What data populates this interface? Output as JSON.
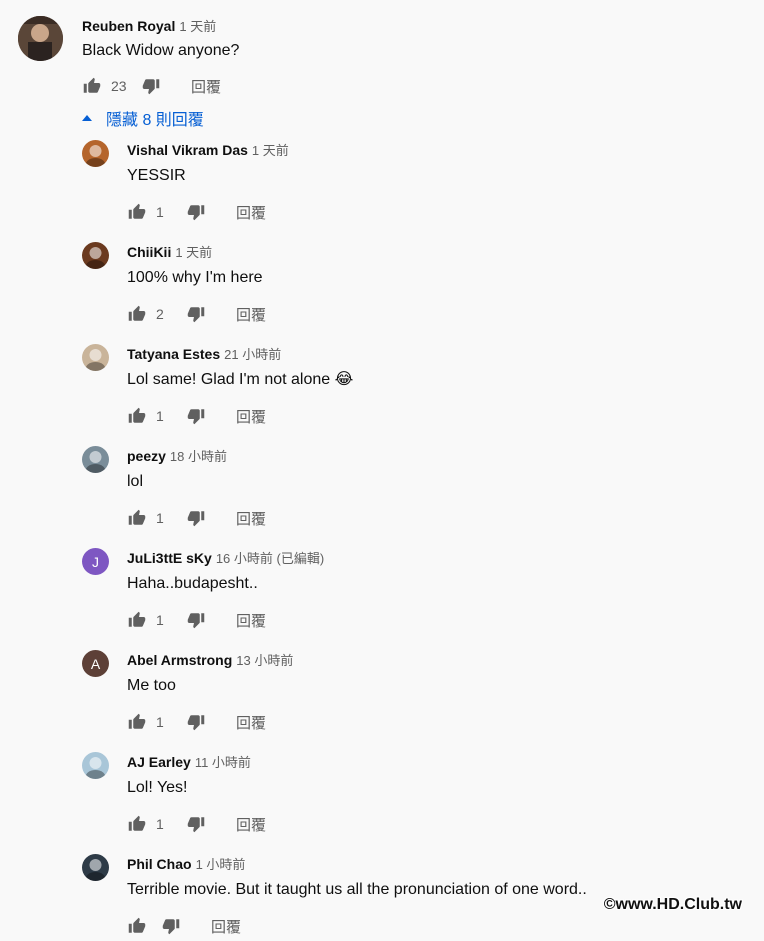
{
  "top_comment": {
    "author": "Reuben Royal",
    "time": "1 天前",
    "text": "Black Widow anyone?",
    "likes": "23",
    "reply_label": "回覆"
  },
  "replies_toggle": {
    "label": "隱藏 8 則回覆"
  },
  "replies": [
    {
      "author": "Vishal Vikram Das",
      "time": "1 天前",
      "text": "YESSIR",
      "likes": "1",
      "reply_label": "回覆",
      "avatar_color": "#b5652c"
    },
    {
      "author": "ChiiKii",
      "time": "1 天前",
      "text": "100% why I'm here",
      "likes": "2",
      "reply_label": "回覆",
      "avatar_color": "#6b3a1f"
    },
    {
      "author": "Tatyana Estes",
      "time": "21 小時前",
      "text": "Lol same! Glad I'm not alone 😂",
      "likes": "1",
      "reply_label": "回覆",
      "avatar_color": "#c9b49a"
    },
    {
      "author": "peezy",
      "time": "18 小時前",
      "text": "lol",
      "likes": "1",
      "reply_label": "回覆",
      "avatar_color": "#7a8d99"
    },
    {
      "author": "JuLi3ttE sKy",
      "time": "16 小時前 (已編輯)",
      "text": "Haha..budapesht..",
      "likes": "1",
      "reply_label": "回覆",
      "avatar_letter": "J",
      "avatar_color": "#7e57c2"
    },
    {
      "author": "Abel Armstrong",
      "time": "13 小時前",
      "text": "Me too",
      "likes": "1",
      "reply_label": "回覆",
      "avatar_letter": "A",
      "avatar_color": "#5d4037"
    },
    {
      "author": "AJ Earley",
      "time": "11 小時前",
      "text": "Lol! Yes!",
      "likes": "1",
      "reply_label": "回覆",
      "avatar_color": "#a9c6d8"
    },
    {
      "author": "Phil Chao",
      "time": "1 小時前",
      "text": "Terrible movie. But it taught us all the pronunciation of one word..",
      "likes": "",
      "reply_label": "回覆",
      "avatar_color": "#2e3b47"
    }
  ],
  "watermark": "©www.HD.Club.tw"
}
